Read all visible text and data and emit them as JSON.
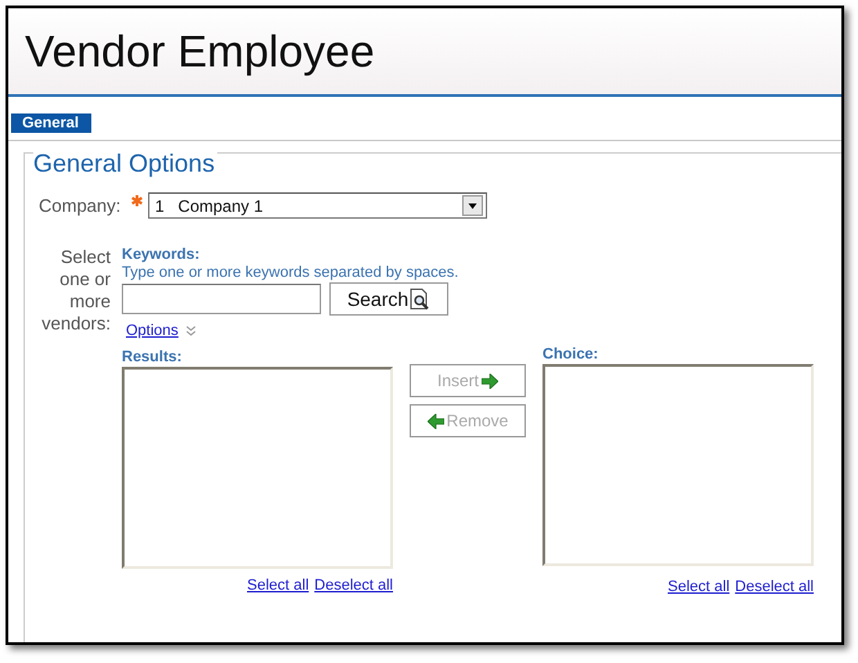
{
  "window": {
    "title": "Vendor Employee"
  },
  "tabs": [
    {
      "label": "General",
      "selected": true
    }
  ],
  "section": {
    "title": "General Options"
  },
  "company": {
    "label": "Company:",
    "required": true,
    "value": "1   Company 1"
  },
  "vendors": {
    "label": "Select one or more vendors:",
    "keywords_label": "Keywords:",
    "hint": "Type one or more keywords separated by spaces.",
    "search_button": "Search",
    "options_link": "Options",
    "results": {
      "label": "Results:",
      "select_all": "Select all",
      "deselect_all": "Deselect all"
    },
    "choice": {
      "label": "Choice:",
      "select_all": "Select all",
      "deselect_all": "Deselect all"
    },
    "buttons": [
      {
        "label": "Insert",
        "kind": "insert",
        "disabled": true
      },
      {
        "label": "Remove",
        "kind": "remove",
        "disabled": true
      }
    ]
  }
}
